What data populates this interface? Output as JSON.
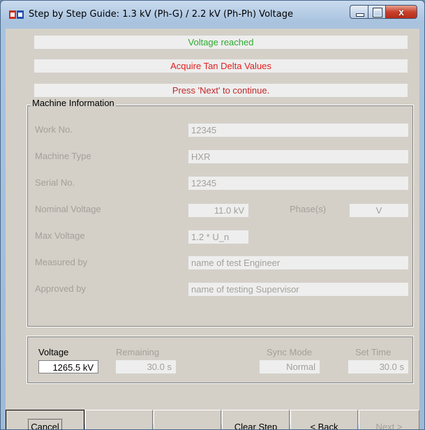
{
  "window": {
    "title": "Step by Step Guide: 1.3 kV (Ph-G) / 2.2 kV (Ph-Ph) Voltage",
    "close_glyph": "x"
  },
  "status": {
    "line1": "Voltage reached",
    "line1_color": "#2eaa2e",
    "line2": "Acquire Tan Delta Values",
    "line2_color": "#e02020",
    "line3": "Press 'Next' to continue.",
    "line3_color": "#c02828"
  },
  "machine_info": {
    "title": "Machine Information",
    "work_no_label": "Work No.",
    "work_no": "12345",
    "machine_type_label": "Machine Type",
    "machine_type": "HXR",
    "serial_no_label": "Serial No.",
    "serial_no": "12345",
    "nominal_voltage_label": "Nominal Voltage",
    "nominal_voltage": "11.0 kV",
    "phase_label": "Phase(s)",
    "phase": "V",
    "max_voltage_label": "Max Voltage",
    "max_voltage": "1.2 * U_n",
    "measured_by_label": "Measured by",
    "measured_by": "name of test Engineer",
    "approved_by_label": "Approved by",
    "approved_by": "name of testing Supervisor"
  },
  "readings": {
    "voltage_label": "Voltage",
    "voltage": "1265.5 kV",
    "remaining_label": "Remaining",
    "remaining": "30.0  s",
    "sync_mode_label": "Sync Mode",
    "sync_mode": "Normal",
    "set_time_label": "Set Time",
    "set_time": "30.0  s"
  },
  "buttons": {
    "cancel": "Cancel",
    "blank1": "",
    "blank2": "",
    "clear_step": "Clear Step",
    "back": "< Back",
    "next": "Next >"
  }
}
